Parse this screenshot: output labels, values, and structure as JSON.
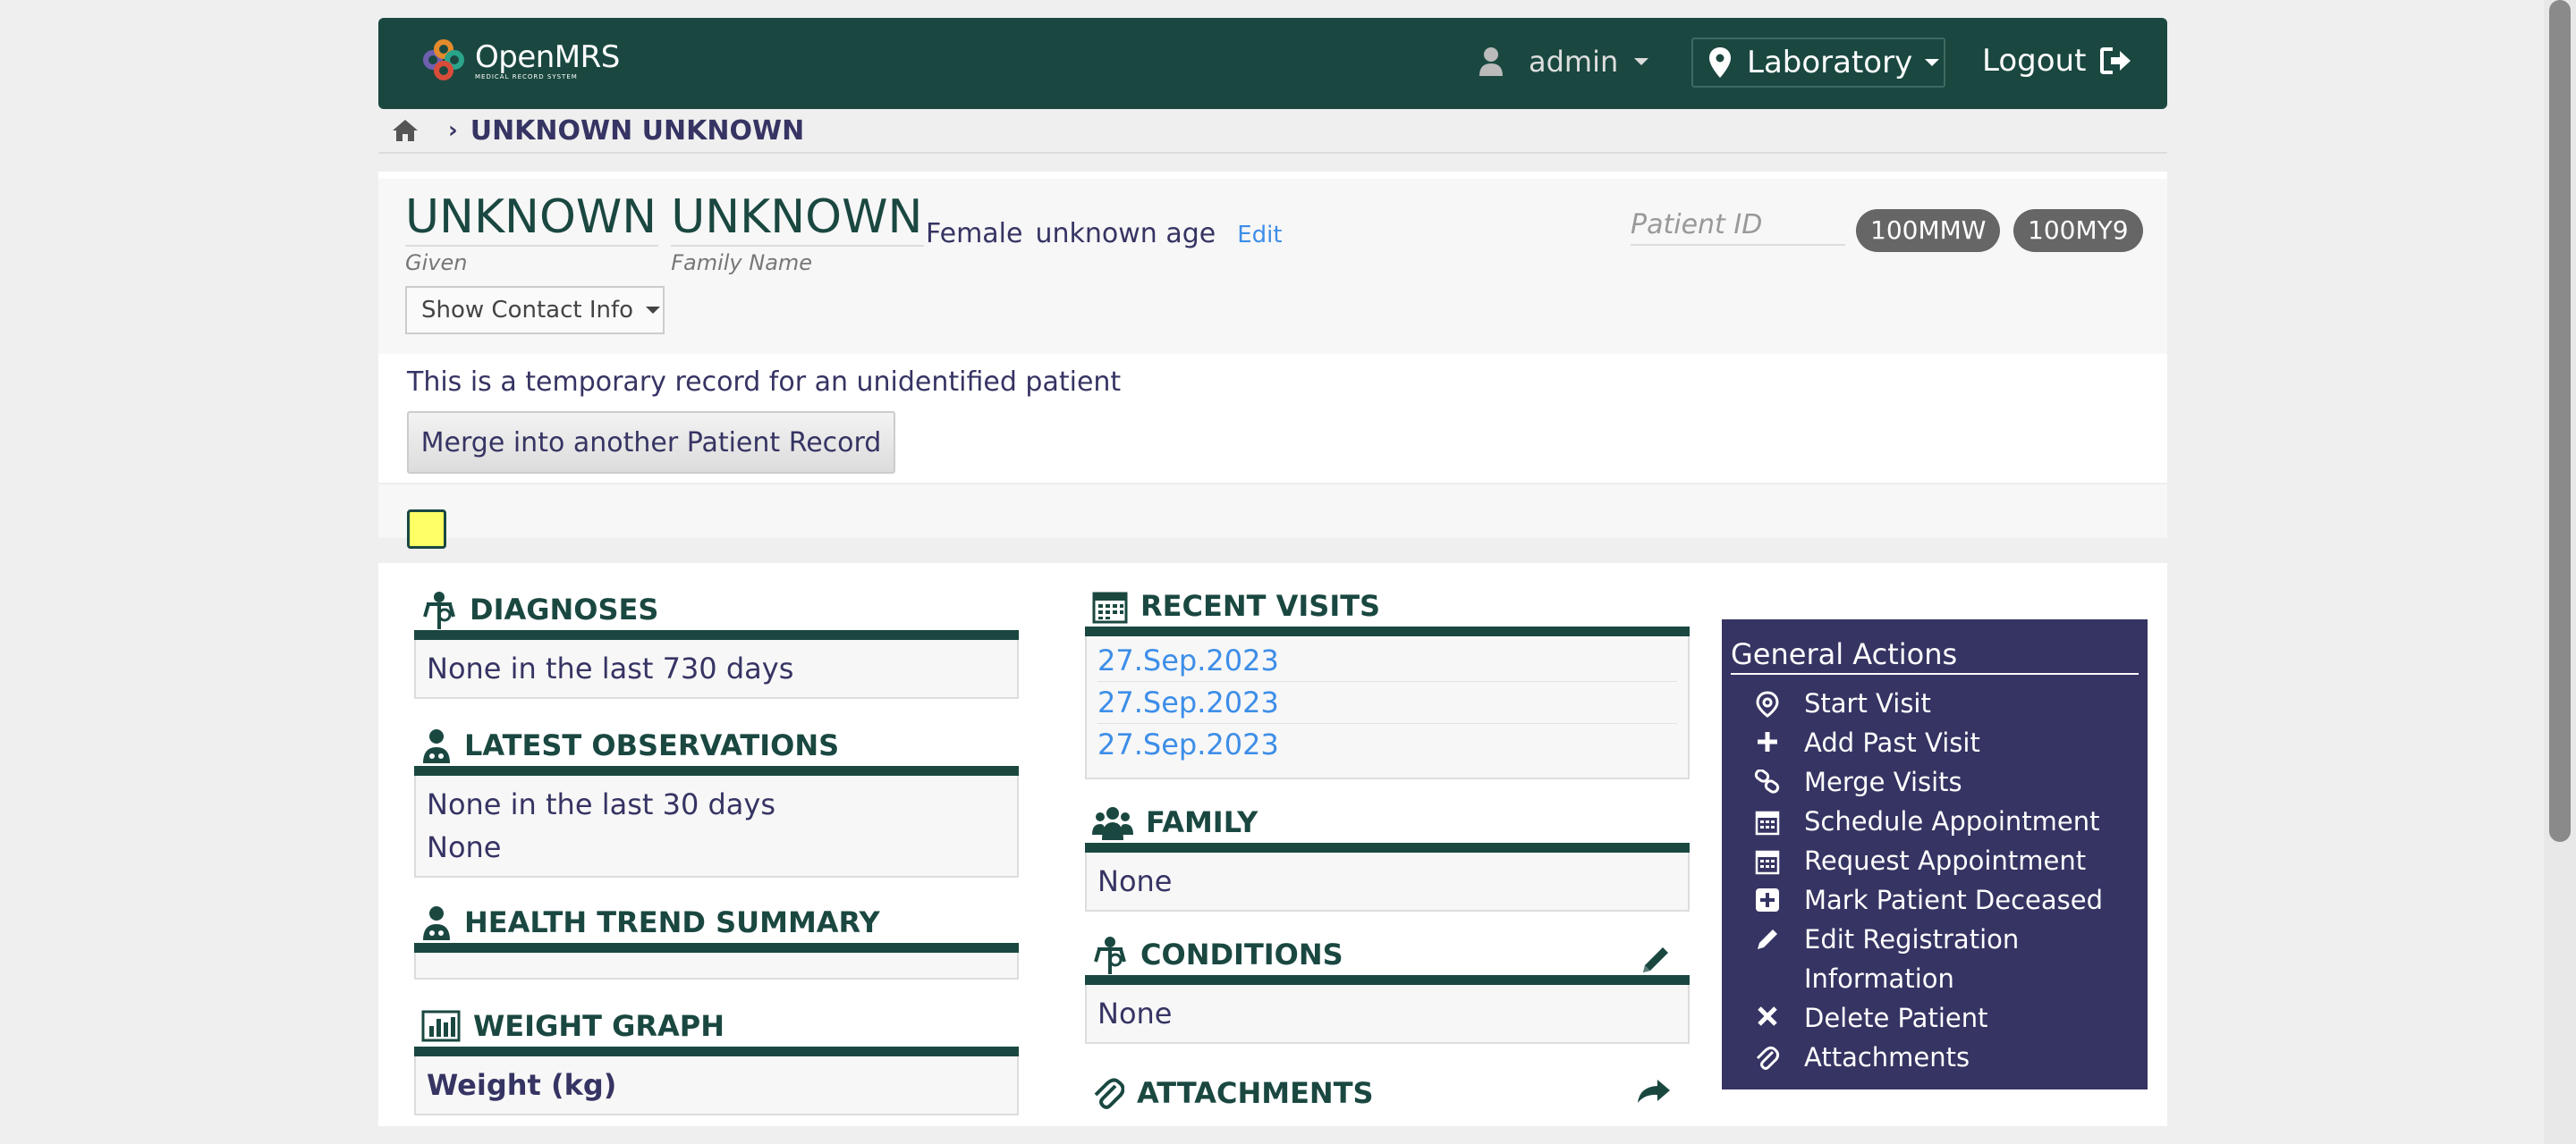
{
  "header": {
    "logo_text": "OpenMRS",
    "logo_subtext": "MEDICAL RECORD SYSTEM",
    "user_label": "admin",
    "location_label": "Laboratory",
    "logout_label": "Logout"
  },
  "breadcrumb": {
    "current": "UNKNOWN UNKNOWN"
  },
  "patient": {
    "given_name": "UNKNOWN",
    "given_label": "Given",
    "family_name": "UNKNOWN",
    "family_label": "Family Name",
    "gender": "Female",
    "age": "unknown age",
    "edit_label": "Edit",
    "patient_id_label": "Patient ID",
    "ids": [
      "100MMW",
      "100MY9"
    ],
    "contact_button": "Show Contact Info",
    "temp_message": "This is a temporary record for an unidentified patient",
    "merge_button": "Merge into another Patient Record"
  },
  "widgets": {
    "diagnoses": {
      "title": "DIAGNOSES",
      "content": "None in the last 730 days"
    },
    "observations": {
      "title": "LATEST OBSERVATIONS",
      "lines": [
        "None in the last 30 days",
        "None"
      ]
    },
    "health_trend": {
      "title": "HEALTH TREND SUMMARY"
    },
    "weight_graph": {
      "title": "WEIGHT GRAPH",
      "content": "Weight (kg)"
    },
    "recent_visits": {
      "title": "RECENT VISITS",
      "visits": [
        "27.Sep.2023",
        "27.Sep.2023",
        "27.Sep.2023"
      ]
    },
    "family": {
      "title": "FAMILY",
      "content": "None"
    },
    "conditions": {
      "title": "CONDITIONS",
      "content": "None"
    },
    "attachments": {
      "title": "ATTACHMENTS"
    }
  },
  "general_actions": {
    "title": "General Actions",
    "items": [
      {
        "label": "Start Visit",
        "icon": "map-pin-icon"
      },
      {
        "label": "Add Past Visit",
        "icon": "plus-icon"
      },
      {
        "label": "Merge Visits",
        "icon": "link-icon"
      },
      {
        "label": "Schedule Appointment",
        "icon": "calendar-icon"
      },
      {
        "label": "Request Appointment",
        "icon": "calendar-icon"
      },
      {
        "label": "Mark Patient Deceased",
        "icon": "plus-square-icon"
      },
      {
        "label": "Edit Registration Information",
        "icon": "pencil-icon"
      },
      {
        "label": "Delete Patient",
        "icon": "x-icon"
      },
      {
        "label": "Attachments",
        "icon": "paperclip-icon"
      }
    ]
  },
  "colors": {
    "brand_dark_green": "#1a4841",
    "actions_purple": "#363463",
    "link_blue": "#3d8ee8",
    "sticky_note_yellow": "#ffff66"
  }
}
